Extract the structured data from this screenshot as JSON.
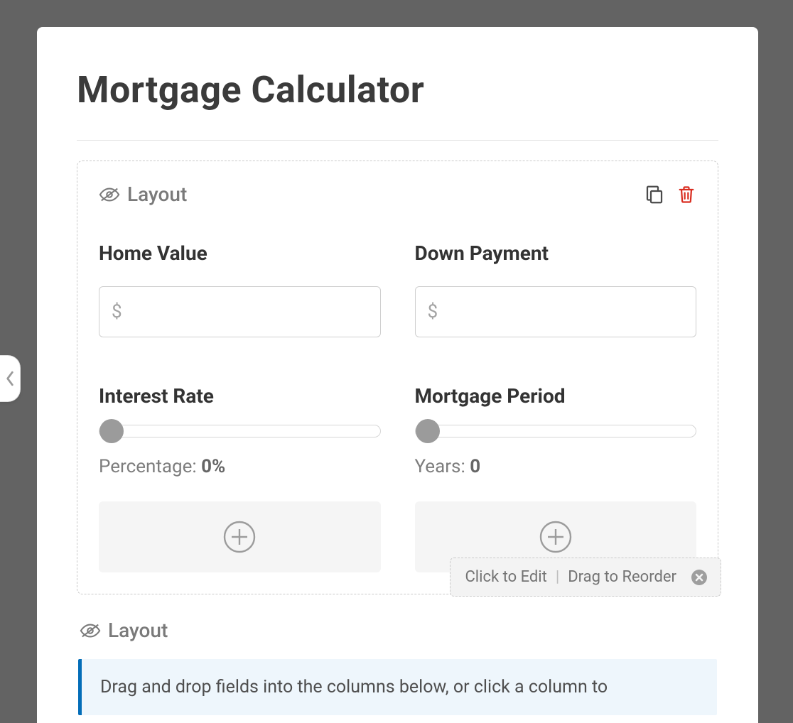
{
  "title": "Mortgage Calculator",
  "layout": {
    "label": "Layout",
    "fields": {
      "home_value": {
        "label": "Home Value",
        "prefix": "$",
        "value": ""
      },
      "down_payment": {
        "label": "Down Payment",
        "prefix": "$",
        "value": ""
      },
      "interest_rate": {
        "label": "Interest Rate",
        "readout_prefix": "Percentage: ",
        "readout_value": "0%",
        "slider_value": "0"
      },
      "mortgage_period": {
        "label": "Mortgage Period",
        "readout_prefix": "Years: ",
        "readout_value": "0",
        "slider_value": "0"
      }
    }
  },
  "tooltip": {
    "edit_text": "Click to Edit",
    "reorder_text": "Drag to Reorder"
  },
  "layout2": {
    "label": "Layout",
    "hint": "Drag and drop fields into the columns below, or click a column to"
  }
}
